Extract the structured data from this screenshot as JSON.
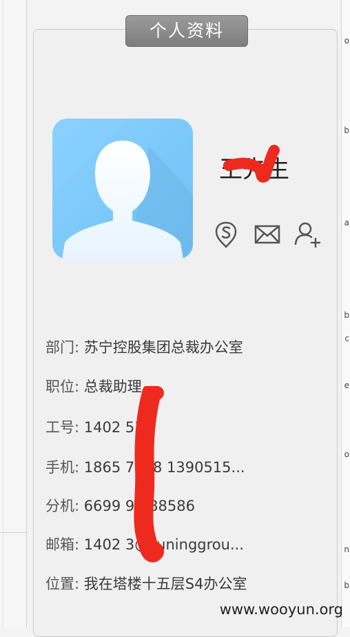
{
  "card": {
    "title": "个人资料"
  },
  "profile": {
    "name": "王先生"
  },
  "actions": [
    {
      "name": "skype-icon"
    },
    {
      "name": "mail-icon"
    },
    {
      "name": "add-contact-icon"
    }
  ],
  "details": {
    "department_label": "部门:",
    "department_value": "苏宁控股集团总裁办公室",
    "position_label": "职位:",
    "position_value": "总裁助理",
    "employee_id_label": "工号:",
    "employee_id_value": "1402 53",
    "mobile_label": "手机:",
    "mobile_value": "1865 7058 1390515...",
    "extension_label": "分机:",
    "extension_value": "6699 9-888586",
    "email_label": "邮箱:",
    "email_value": "1402 3@suninggrou...",
    "location_label": "位置:",
    "location_value": "我在塔楼十五层S4办公室"
  },
  "edge_letters": [
    "o",
    "b",
    "a",
    "b",
    "c",
    "e",
    "o",
    "n",
    "b"
  ],
  "watermark": "www.wooyun.org",
  "colors": {
    "redaction": "#ee2a1f",
    "avatar_bg": "#7cc8fb",
    "title_bg": "#8a8a8a"
  }
}
